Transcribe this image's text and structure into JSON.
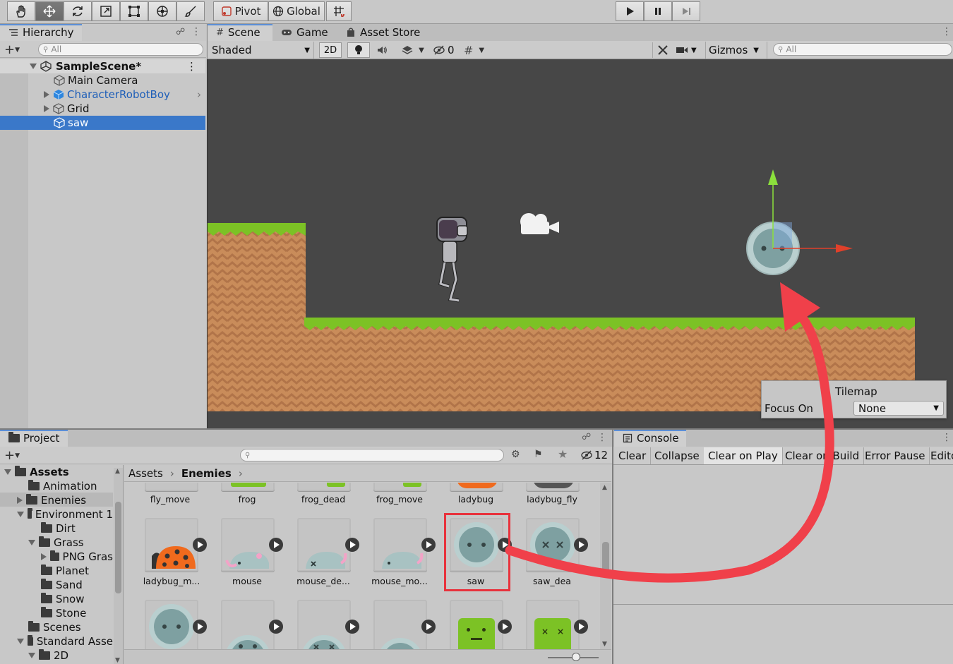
{
  "toolbar": {
    "pivot_label": "Pivot",
    "global_label": "Global",
    "tools": [
      "hand-tool-icon",
      "move-tool-icon",
      "rotate-tool-icon",
      "scale-tool-icon",
      "rect-tool-icon",
      "transform-tool-icon",
      "brush-tool-icon"
    ]
  },
  "hierarchy": {
    "tab_label": "Hierarchy",
    "search_placeholder": "All",
    "scene_name": "SampleScene*",
    "items": [
      {
        "label": "Main Camera"
      },
      {
        "label": "CharacterRobotBoy"
      },
      {
        "label": "Grid"
      },
      {
        "label": "saw"
      }
    ]
  },
  "scene": {
    "tabs": [
      {
        "label": "Scene"
      },
      {
        "label": "Game"
      },
      {
        "label": "Asset Store"
      }
    ],
    "shading_mode": "Shaded",
    "mode_2d": "2D",
    "hidden_count": "0",
    "gizmos_label": "Gizmos",
    "search_placeholder": "All",
    "tilemap_panel": {
      "title": "Tilemap",
      "focus_label": "Focus On",
      "focus_value": "None"
    }
  },
  "project": {
    "tab_label": "Project",
    "hidden_count": "12",
    "tree": [
      {
        "label": "Assets"
      },
      {
        "label": "Animation"
      },
      {
        "label": "Enemies"
      },
      {
        "label": "Environment 1"
      },
      {
        "label": "Dirt"
      },
      {
        "label": "Grass"
      },
      {
        "label": "PNG Gras"
      },
      {
        "label": "Planet"
      },
      {
        "label": "Sand"
      },
      {
        "label": "Snow"
      },
      {
        "label": "Stone"
      },
      {
        "label": "Scenes"
      },
      {
        "label": "Standard Asse"
      },
      {
        "label": "2D"
      }
    ],
    "breadcrumb": {
      "root": "Assets",
      "current": "Enemies"
    },
    "row1": [
      "fly_move",
      "frog",
      "frog_dead",
      "frog_move",
      "ladybug",
      "ladybug_fly"
    ],
    "row2": [
      "ladybug_m...",
      "mouse",
      "mouse_de...",
      "mouse_mo...",
      "saw",
      "saw_dea"
    ]
  },
  "console": {
    "tab_label": "Console",
    "buttons": [
      {
        "label": "Clear"
      },
      {
        "label": "Collapse"
      },
      {
        "label": "Clear on Play"
      },
      {
        "label": "Clear on Build"
      },
      {
        "label": "Error Pause"
      },
      {
        "label": "Edito"
      }
    ]
  },
  "colors": {
    "selection": "#3a78c9",
    "highlight_box": "#e8323c",
    "arrow": "#f0404a",
    "scene_bg": "#474747",
    "grass": "#7cc225",
    "dirt": "#c98c5a"
  }
}
